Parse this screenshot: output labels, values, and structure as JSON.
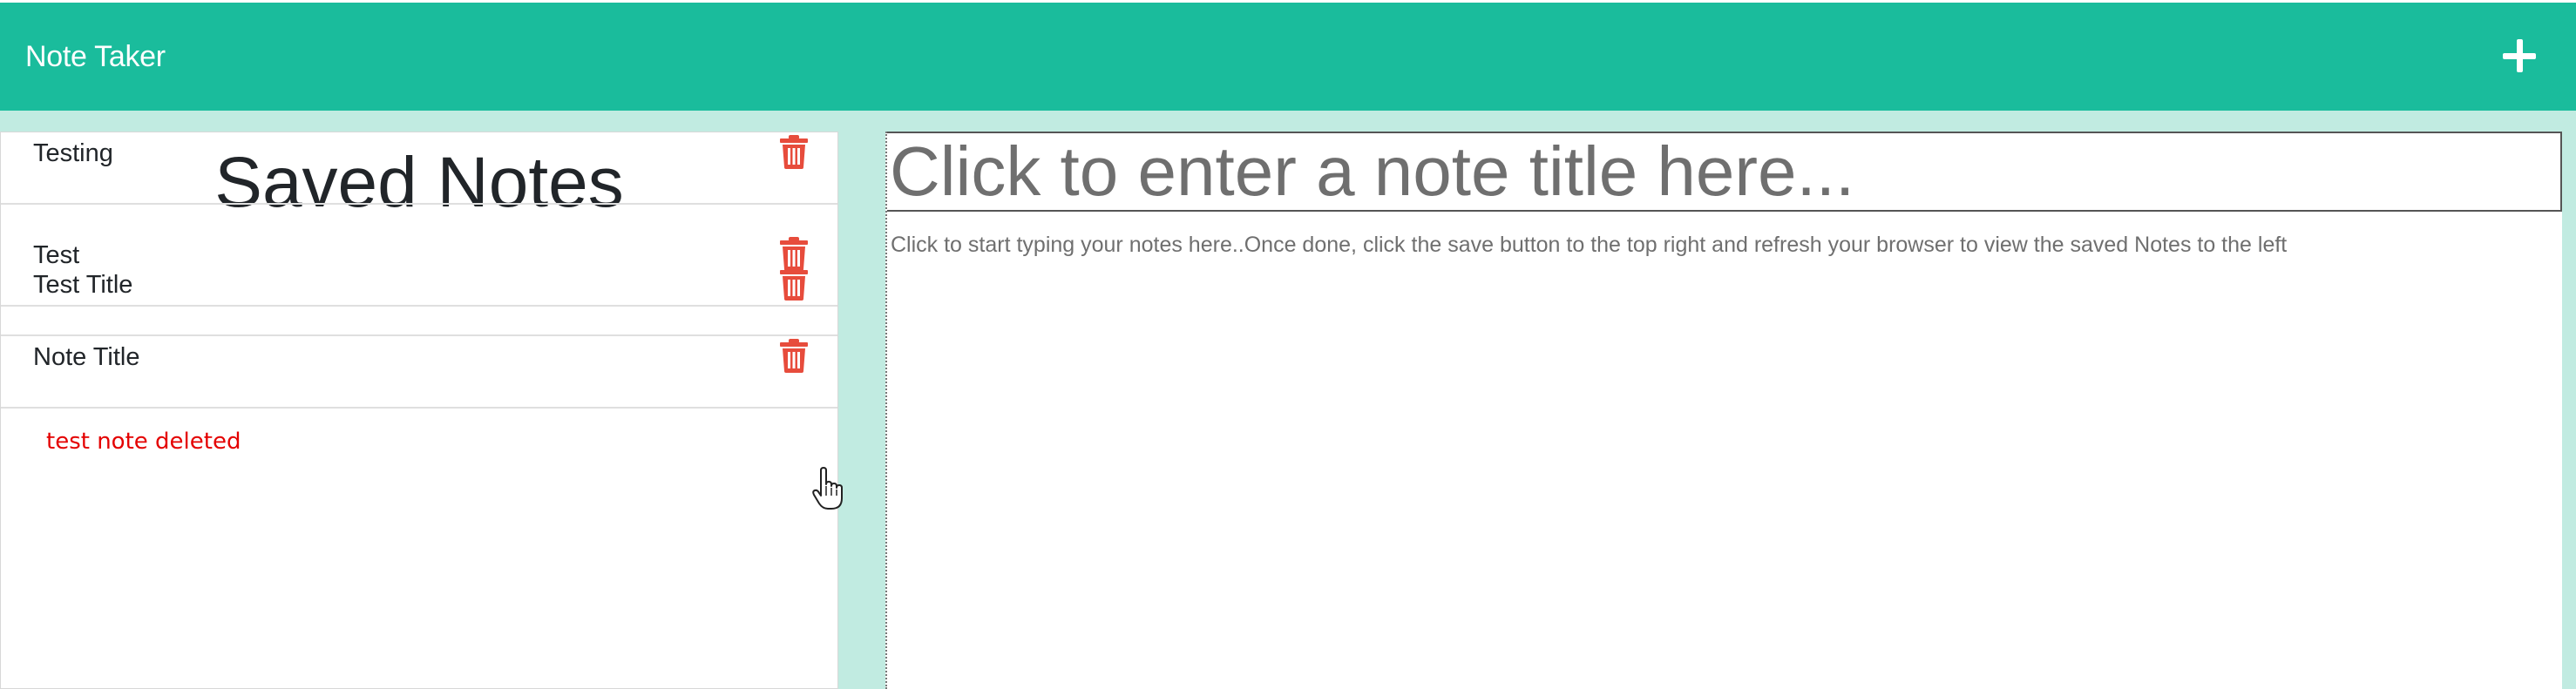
{
  "navbar": {
    "title": "Note Taker",
    "new_note_icon": "plus-icon"
  },
  "sidebar": {
    "heading": "Saved Notes",
    "delete_icon": "trash-icon",
    "notes": [
      {
        "title": "Test Title"
      },
      {
        "title": "Testing"
      },
      {
        "title": "Test"
      },
      {
        "title": "Note Title"
      }
    ],
    "status_message": "test note deleted"
  },
  "editor": {
    "title_placeholder": "Click to enter a note title here...",
    "text_placeholder": "Click to start typing your notes here..Once done, click the save button to the top right and refresh your browser to view the saved Notes to the left"
  },
  "colors": {
    "navbar": "#1abc9c",
    "background": "#c1ebe1",
    "delete": "#e74c3c",
    "status": "#e40000"
  }
}
